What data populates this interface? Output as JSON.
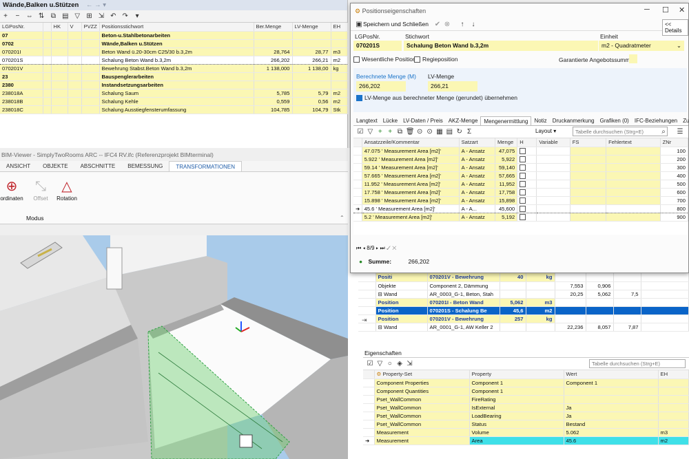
{
  "top_grid": {
    "title": "Wände,Balken u.Stützen",
    "nav_arrows": "← → ▾",
    "toolbar_icons": [
      "add-icon",
      "remove-icon",
      "move-icon",
      "copy-icon",
      "paste-icon",
      "filter-icon",
      "tree-icon",
      "sort-icon",
      "export-icon",
      "undo-icon",
      "redo-icon",
      "settings-icon"
    ],
    "columns": [
      "LGPosNr.",
      "",
      "HK",
      "V",
      "PVZZ",
      "Positionsstichwort",
      "Ber.Menge",
      "LV-Menge",
      "EH"
    ],
    "rows": [
      {
        "lg": "07",
        "txt": "Beton-u.Stahlbetonarbeiten",
        "ber": "",
        "lv": "",
        "eh": "",
        "bold": true
      },
      {
        "lg": "0702",
        "txt": "Wände,Balken u.Stützen",
        "ber": "",
        "lv": "",
        "eh": "",
        "bold": true
      },
      {
        "lg": "070201I",
        "txt": "Beton Wand ü.20-30cm C25/30 b.3,2m",
        "ber": "28,764",
        "lv": "28,77",
        "eh": "m3"
      },
      {
        "lg": "070201S",
        "txt": "Schalung Beton Wand  b.3,2m",
        "ber": "266,202",
        "lv": "266,21",
        "eh": "m2",
        "sel": true
      },
      {
        "lg": "070201V",
        "txt": "Bewehrung Stabst.Beton Wand b.3,2m",
        "ber": "1 138,000",
        "lv": "1 138,00",
        "eh": "kg"
      },
      {
        "lg": "23",
        "txt": "Bauspenglerarbeiten",
        "ber": "",
        "lv": "",
        "eh": "",
        "bold": true
      },
      {
        "lg": "2380",
        "txt": "Instandsetzungsarbeiten",
        "ber": "",
        "lv": "",
        "eh": "",
        "bold": true
      },
      {
        "lg": "238018A",
        "txt": "Schalung Saum",
        "ber": "5,785",
        "lv": "5,79",
        "eh": "m2"
      },
      {
        "lg": "238018B",
        "txt": "Schalung Kehle",
        "ber": "0,559",
        "lv": "0,56",
        "eh": "m2"
      },
      {
        "lg": "238018C",
        "txt": "Schalung Ausstiegfensterumfassung",
        "ber": "104,785",
        "lv": "104,79",
        "eh": "Stk"
      }
    ]
  },
  "bim": {
    "title": "BIM-Viewer -  SimplyTwoRooms ARC -- IFC4 RV.ifc (Referenzprojekt BIMterminal)",
    "tabs": [
      "ANSICHT",
      "OBJEKTE",
      "ABSCHNITTE",
      "BEMESSUNG",
      "TRANSFORMATIONEN"
    ],
    "ribbon": [
      "ordinaten",
      "Offset",
      "Rotation"
    ],
    "group_label": "Modus"
  },
  "dialog": {
    "title": "Positionseigenschaften",
    "save_label": "Speichern und Schließen",
    "details_label": "<< Details",
    "lg_label": "LGPosNr.",
    "lg_value": "070201S",
    "stw_label": "Stichwort",
    "stw_value": "Schalung Beton Wand  b.3,2m",
    "eh_label": "Einheit",
    "eh_value": "m2 - Quadratmeter",
    "chk_wesentlich": "Wesentliche Position",
    "chk_regie": "Regieposition",
    "garantiert": "Garantierte Angebotssumme",
    "ber_label": "Berechnete Menge (M)",
    "ber_value": "266,202",
    "lv_label": "LV-Menge",
    "lv_value": "266,21",
    "uebernehmen": "LV-Menge aus berechneter Menge (gerundet) übernehmen",
    "tabs": [
      "Langtext",
      "Lücke",
      "LV-Daten / Preis",
      "AKZ-Menge",
      "Mengenermittlung",
      "Notiz",
      "Druckanmerkung",
      "Grafiken (0)",
      "IFC-Beziehungen",
      "Zu"
    ],
    "layout_label": "Layout",
    "search_placeholder": "Tabelle durchsuchen (Strg+E)",
    "grid_cols": [
      "Ansatzzeile/Kommentar",
      "Satzart",
      "Menge",
      "H",
      "Variable",
      "FS",
      "Fehlertext",
      "ZNr"
    ],
    "grid_rows": [
      {
        "a": "47.075 ' Measurement Area [m2]'",
        "s": "A - Ansatz",
        "m": "47,075",
        "z": "100"
      },
      {
        "a": "5.922 ' Measurement Area [m2]'",
        "s": "A - Ansatz",
        "m": "5,922",
        "z": "200"
      },
      {
        "a": "59.14 ' Measurement Area [m2]'",
        "s": "A - Ansatz",
        "m": "59,140",
        "z": "300"
      },
      {
        "a": "57.665 ' Measurement Area [m2]'",
        "s": "A - Ansatz",
        "m": "57,665",
        "z": "400"
      },
      {
        "a": "11.952 ' Measurement Area [m2]'",
        "s": "A - Ansatz",
        "m": "11,952",
        "z": "500"
      },
      {
        "a": "17.758 ' Measurement Area [m2]'",
        "s": "A - Ansatz",
        "m": "17,758",
        "z": "600"
      },
      {
        "a": "15.898 ' Measurement Area [m2]'",
        "s": "A - Ansatz",
        "m": "15,898",
        "z": "700"
      },
      {
        "a": "45.6 ' Measurement Area [m2]'",
        "s": "A - A...",
        "m": "45,600",
        "z": "800",
        "cur": true
      },
      {
        "a": "5.2 ' Measurement Area [m2]'",
        "s": "A - Ansatz",
        "m": "5,192",
        "z": "900"
      }
    ],
    "pager": "8/9",
    "summe_label": "Summe:",
    "summe_value": "266,202"
  },
  "ifc_tree": {
    "rows": [
      {
        "c1": "Positi",
        "c2": "070201V - Bewehrung",
        "c3": "40",
        "c4": "kg",
        "c5": "",
        "c6": "",
        "c7": "",
        "kind": "pos"
      },
      {
        "c1": "Objekte",
        "c2": "Component 2, Dämmung",
        "c3": "",
        "c4": "",
        "c5": "7,553",
        "c6": "0,906",
        "c7": "",
        "kind": "obj"
      },
      {
        "c1": "⊟ Wand",
        "c2": "AR_0003_G-1, Beton, Stah",
        "c3": "",
        "c4": "",
        "c5": "20,25",
        "c6": "5,062",
        "c7": "7,5",
        "kind": "obj"
      },
      {
        "c1": "Position",
        "c2": "070201I - Beton Wand",
        "c3": "5,062",
        "c4": "m3",
        "c5": "",
        "c6": "",
        "c7": "",
        "kind": "pos"
      },
      {
        "c1": "Position",
        "c2": "070201S - Schalung Be",
        "c3": "45,6",
        "c4": "m2",
        "c5": "",
        "c6": "",
        "c7": "",
        "kind": "sel"
      },
      {
        "c1": "Position",
        "c2": "070201V - Bewehrung",
        "c3": "257",
        "c4": "kg",
        "c5": "",
        "c6": "",
        "c7": "",
        "kind": "pos"
      },
      {
        "c1": "⊟ Wand",
        "c2": "AR_0001_G-1, AW Keller 2",
        "c3": "",
        "c4": "",
        "c5": "22,236",
        "c6": "8,057",
        "c7": "7,87",
        "kind": "obj"
      }
    ]
  },
  "props": {
    "title": "Eigenschaften",
    "search_placeholder": "Tabelle durchsuchen (Strg+E)",
    "cols": [
      "Property-Set",
      "Property",
      "Wert",
      "EH"
    ],
    "rows": [
      {
        "ps": "Component Properties",
        "p": "Component 1",
        "w": "Component 1",
        "eh": ""
      },
      {
        "ps": "Component Quantities",
        "p": "Component 1",
        "w": "",
        "eh": ""
      },
      {
        "ps": "Pset_WallCommon",
        "p": "FireRating",
        "w": "",
        "eh": ""
      },
      {
        "ps": "Pset_WallCommon",
        "p": "IsExternal",
        "w": "Ja",
        "eh": ""
      },
      {
        "ps": "Pset_WallCommon",
        "p": "LoadBearing",
        "w": "Ja",
        "eh": ""
      },
      {
        "ps": "Pset_WallCommon",
        "p": "Status",
        "w": "Bestand",
        "eh": ""
      },
      {
        "ps": "Measurement",
        "p": "Volume",
        "w": "5.062",
        "eh": "m3"
      },
      {
        "ps": "Measurement",
        "p": "Area",
        "w": "45.6",
        "eh": "m2",
        "cur": true
      }
    ]
  },
  "colors": {
    "yellow": "#fbf7b4",
    "selection": "#0a64c8",
    "cyan": "#3fe0e8",
    "accent": "#1e5ca8"
  }
}
